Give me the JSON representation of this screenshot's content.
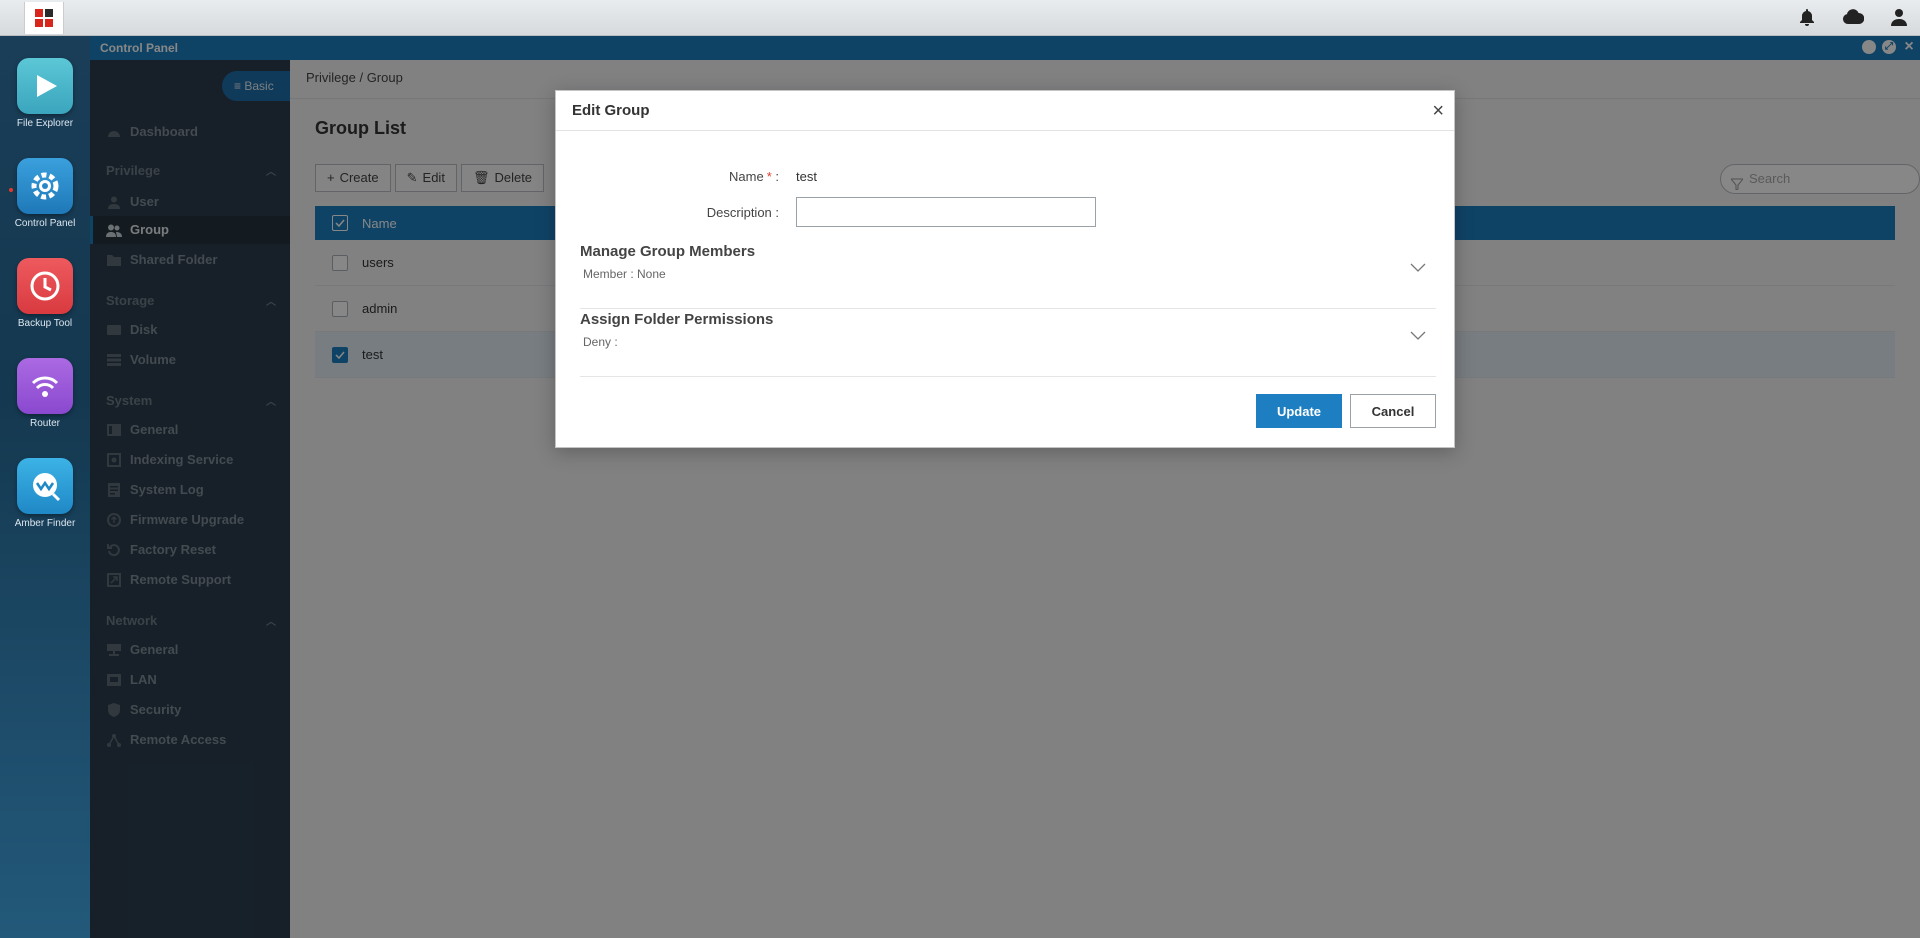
{
  "window": {
    "title": "Control Panel"
  },
  "dock": [
    {
      "label": "File Explorer",
      "icon": "play-triangle-icon",
      "color": "#46b6c9"
    },
    {
      "label": "Control Panel",
      "icon": "gear-icon",
      "color": "#2d8fd0"
    },
    {
      "label": "Backup Tool",
      "icon": "clock-icon",
      "color": "#e5484d"
    },
    {
      "label": "Router",
      "icon": "wifi-icon",
      "color": "#9a5bd6"
    },
    {
      "label": "Amber Finder",
      "icon": "amber-finder-icon",
      "color": "#2a9fd9"
    }
  ],
  "sidebar": {
    "mode_label": "Basic",
    "dashboard": "Dashboard",
    "sections": {
      "privilege": "Privilege",
      "storage": "Storage",
      "system": "System",
      "network": "Network"
    },
    "items": {
      "user": "User",
      "group": "Group",
      "shared_folder": "Shared Folder",
      "disk": "Disk",
      "volume": "Volume",
      "general": "General",
      "indexing": "Indexing Service",
      "system_log": "System Log",
      "firmware": "Firmware Upgrade",
      "factory_reset": "Factory Reset",
      "remote_support": "Remote Support",
      "net_general": "General",
      "lan": "LAN",
      "security": "Security",
      "remote_access": "Remote Access"
    }
  },
  "main": {
    "breadcrumb": "Privilege / Group",
    "title": "Group List",
    "toolbar": {
      "create": "Create",
      "edit": "Edit",
      "delete": "Delete"
    },
    "search_placeholder": "Search",
    "table": {
      "header": "Name",
      "rows": [
        {
          "name": "users",
          "checked": false
        },
        {
          "name": "admin",
          "checked": false
        },
        {
          "name": "test",
          "checked": true
        }
      ]
    }
  },
  "modal": {
    "title": "Edit Group",
    "name_label": "Name",
    "name_required": "*",
    "name_colon": ":",
    "name_value": "test",
    "description_label": "Description :",
    "description_value": "",
    "members_title": "Manage Group Members",
    "members_sub": "Member : None",
    "permissions_title": "Assign Folder Permissions",
    "permissions_sub": "Deny :",
    "update": "Update",
    "cancel": "Cancel"
  }
}
